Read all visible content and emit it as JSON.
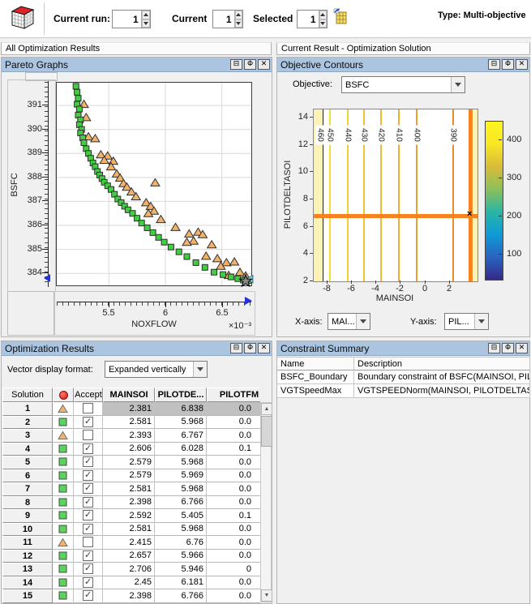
{
  "toolbar": {
    "cube_icon": "multiobjective-cube-icon",
    "current_run_label": "Current run:",
    "current_run_value": "1",
    "current_label": "Current",
    "current_value": "1",
    "selected_label": "Selected",
    "selected_value": "1",
    "select_solution_icon": "select-solution-table-icon",
    "type_text": "Type: Multi-objective"
  },
  "sections": {
    "left_header": "All Optimization Results",
    "right_header": "Current Result - Optimization Solution"
  },
  "panel_buttons": {
    "split": "⊟",
    "dock": "Φ",
    "close": "✕"
  },
  "pareto_panel": {
    "title": "Pareto Graphs"
  },
  "contours_panel": {
    "title": "Objective Contours",
    "objective_label": "Objective:",
    "objective_value": "BSFC",
    "xaxis_label": "X-axis:",
    "xaxis_value": "MAI...",
    "yaxis_label": "Y-axis:",
    "yaxis_value": "PIL..."
  },
  "results_panel": {
    "title": "Optimization Results",
    "vector_format_label": "Vector display format:",
    "vector_format_value": "Expanded vertically",
    "columns": {
      "solution": "Solution",
      "accept": "Accept",
      "mainsoi": "MAINSOI",
      "pilotde": "PILOTDE...",
      "pilotfm": "PILOTFM"
    },
    "rows": [
      {
        "solution": "1",
        "marker": "triangle",
        "accept": false,
        "selected": true,
        "mainsoi": "2.381",
        "pilotde": "6.838",
        "pilotfm": "0.0"
      },
      {
        "solution": "2",
        "marker": "square",
        "accept": true,
        "selected": false,
        "mainsoi": "2.581",
        "pilotde": "5.968",
        "pilotfm": "0.0"
      },
      {
        "solution": "3",
        "marker": "triangle",
        "accept": false,
        "selected": false,
        "mainsoi": "2.393",
        "pilotde": "6.767",
        "pilotfm": "0.0"
      },
      {
        "solution": "4",
        "marker": "square",
        "accept": true,
        "selected": false,
        "mainsoi": "2.606",
        "pilotde": "6.028",
        "pilotfm": "0.1"
      },
      {
        "solution": "5",
        "marker": "square",
        "accept": true,
        "selected": false,
        "mainsoi": "2.579",
        "pilotde": "5.968",
        "pilotfm": "0.0"
      },
      {
        "solution": "6",
        "marker": "square",
        "accept": true,
        "selected": false,
        "mainsoi": "2.579",
        "pilotde": "5.969",
        "pilotfm": "0.0"
      },
      {
        "solution": "7",
        "marker": "square",
        "accept": true,
        "selected": false,
        "mainsoi": "2.581",
        "pilotde": "5.968",
        "pilotfm": "0.0"
      },
      {
        "solution": "8",
        "marker": "square",
        "accept": true,
        "selected": false,
        "mainsoi": "2.398",
        "pilotde": "6.766",
        "pilotfm": "0.0"
      },
      {
        "solution": "9",
        "marker": "square",
        "accept": true,
        "selected": false,
        "mainsoi": "2.592",
        "pilotde": "5.405",
        "pilotfm": "0.1"
      },
      {
        "solution": "10",
        "marker": "square",
        "accept": true,
        "selected": false,
        "mainsoi": "2.581",
        "pilotde": "5.968",
        "pilotfm": "0.0"
      },
      {
        "solution": "11",
        "marker": "triangle",
        "accept": false,
        "selected": false,
        "mainsoi": "2.415",
        "pilotde": "6.76",
        "pilotfm": "0.0"
      },
      {
        "solution": "12",
        "marker": "square",
        "accept": true,
        "selected": false,
        "mainsoi": "2.657",
        "pilotde": "5.966",
        "pilotfm": "0.0"
      },
      {
        "solution": "13",
        "marker": "square",
        "accept": true,
        "selected": false,
        "mainsoi": "2.706",
        "pilotde": "5.946",
        "pilotfm": "0"
      },
      {
        "solution": "14",
        "marker": "square",
        "accept": true,
        "selected": false,
        "mainsoi": "2.45",
        "pilotde": "6.181",
        "pilotfm": "0.0"
      },
      {
        "solution": "15",
        "marker": "square",
        "accept": true,
        "selected": false,
        "mainsoi": "2.398",
        "pilotde": "6.766",
        "pilotfm": "0.0"
      }
    ]
  },
  "constraints_panel": {
    "title": "Constraint Summary",
    "columns": {
      "name": "Name",
      "description": "Description"
    },
    "rows": [
      {
        "name": "BSFC_Boundary",
        "description": "Boundary constraint of BSFC(MAINSOI, PILOT"
      },
      {
        "name": "VGTSpeedMax",
        "description": "VGTSPEEDNorm(MAINSOI, PILOTDELTASOI, P"
      }
    ]
  },
  "chart_data": [
    {
      "type": "scatter",
      "title": "Pareto Graphs",
      "xlabel": "NOXFLOW",
      "x_scale_note": "×10⁻³",
      "ylabel": "BSFC",
      "x_unit": "1e-3",
      "xlim": [
        5.04,
        6.76
      ],
      "ylim": [
        383.5,
        391.95
      ],
      "xticks": [
        5.5,
        6,
        6.5
      ],
      "yticks": [
        384,
        385,
        386,
        387,
        388,
        389,
        390,
        391
      ],
      "grid": true,
      "series": [
        {
          "name": "dominated-solutions",
          "marker": "triangle",
          "color": "#f3b269",
          "points": [
            [
              5.28,
              391.05
            ],
            [
              5.3,
              390.5
            ],
            [
              5.32,
              389.7
            ],
            [
              5.38,
              389.62
            ],
            [
              5.43,
              388.95
            ],
            [
              5.49,
              388.9
            ],
            [
              5.46,
              388.72
            ],
            [
              5.54,
              388.68
            ],
            [
              5.52,
              388.45
            ],
            [
              5.57,
              388.15
            ],
            [
              5.6,
              387.98
            ],
            [
              5.63,
              387.75
            ],
            [
              5.66,
              387.6
            ],
            [
              5.91,
              387.78
            ],
            [
              5.7,
              387.4
            ],
            [
              5.74,
              387.2
            ],
            [
              5.83,
              386.95
            ],
            [
              5.87,
              386.8
            ],
            [
              5.9,
              386.6
            ],
            [
              5.85,
              386.5
            ],
            [
              5.96,
              386.25
            ],
            [
              6.09,
              385.92
            ],
            [
              6.21,
              385.65
            ],
            [
              6.29,
              385.72
            ],
            [
              6.33,
              385.62
            ],
            [
              6.25,
              385.35
            ],
            [
              6.19,
              385.3
            ],
            [
              6.41,
              385.2
            ],
            [
              6.36,
              384.72
            ],
            [
              6.46,
              384.62
            ],
            [
              6.54,
              384.45
            ],
            [
              6.61,
              384.48
            ],
            [
              6.49,
              384.3
            ],
            [
              6.66,
              384.05
            ],
            [
              6.56,
              383.92
            ],
            [
              6.71,
              383.9
            ]
          ]
        },
        {
          "name": "pareto-front-solutions",
          "marker": "square",
          "color": "#3fcf3f",
          "points": [
            [
              5.21,
              391.8
            ],
            [
              5.22,
              391.55
            ],
            [
              5.23,
              391.3
            ],
            [
              5.22,
              391.05
            ],
            [
              5.24,
              390.85
            ],
            [
              5.23,
              390.6
            ],
            [
              5.25,
              390.4
            ],
            [
              5.24,
              390.2
            ],
            [
              5.26,
              390.0
            ],
            [
              5.25,
              389.85
            ],
            [
              5.27,
              389.65
            ],
            [
              5.28,
              389.45
            ],
            [
              5.3,
              389.2
            ],
            [
              5.32,
              389.0
            ],
            [
              5.34,
              388.8
            ],
            [
              5.36,
              388.6
            ],
            [
              5.38,
              388.45
            ],
            [
              5.4,
              388.25
            ],
            [
              5.42,
              388.1
            ],
            [
              5.44,
              387.95
            ],
            [
              5.46,
              387.8
            ],
            [
              5.49,
              387.65
            ],
            [
              5.52,
              387.5
            ],
            [
              5.55,
              387.3
            ],
            [
              5.58,
              387.1
            ],
            [
              5.61,
              386.95
            ],
            [
              5.64,
              386.8
            ],
            [
              5.67,
              386.65
            ],
            [
              5.71,
              386.5
            ],
            [
              5.75,
              386.3
            ],
            [
              5.79,
              386.1
            ],
            [
              5.84,
              385.9
            ],
            [
              5.89,
              385.7
            ],
            [
              5.94,
              385.5
            ],
            [
              5.99,
              385.3
            ],
            [
              6.05,
              385.1
            ],
            [
              6.12,
              384.9
            ],
            [
              6.19,
              384.7
            ],
            [
              6.27,
              384.45
            ],
            [
              6.35,
              384.25
            ],
            [
              6.43,
              384.05
            ],
            [
              6.51,
              383.95
            ],
            [
              6.58,
              383.85
            ],
            [
              6.64,
              383.78
            ],
            [
              6.69,
              383.72
            ],
            [
              6.73,
              383.7
            ]
          ]
        },
        {
          "name": "current-solution",
          "marker": "triangle-left",
          "color": "#8adbe8",
          "points": [
            [
              6.745,
              383.76
            ]
          ]
        },
        {
          "name": "selected-solution",
          "marker": "star",
          "color": "#888888",
          "points": [
            [
              6.71,
              383.68
            ]
          ]
        }
      ]
    },
    {
      "type": "contour",
      "objective": "BSFC",
      "xlabel": "MAINSOI",
      "ylabel": "PILOTDELTASOI",
      "xlim": [
        -9.1,
        4.25
      ],
      "ylim": [
        2,
        14.6
      ],
      "xticks": [
        -8,
        -6,
        -4,
        -2,
        0,
        2
      ],
      "yticks": [
        2,
        4,
        6,
        8,
        10,
        12,
        14
      ],
      "contour_levels": [
        {
          "value": 460,
          "x": -8.6,
          "color": "#f2e338"
        },
        {
          "value": 450,
          "x": -7.75,
          "color": "#f2dc36"
        },
        {
          "value": 440,
          "x": -6.3,
          "color": "#f1d034"
        },
        {
          "value": 430,
          "x": -5.0,
          "color": "#f0c433"
        },
        {
          "value": 420,
          "x": -3.6,
          "color": "#efb931"
        },
        {
          "value": 410,
          "x": -2.15,
          "color": "#eeac30"
        },
        {
          "value": 400,
          "x": -0.7,
          "color": "#ed9f2e"
        },
        {
          "value": 390,
          "x": 2.25,
          "color": "#ea8f28"
        }
      ],
      "boundary_band": {
        "x_from": -9.1,
        "x_to": -8.35,
        "color": "#faf3b5"
      },
      "right_band": {
        "x_from": 3.95,
        "x_to": 4.25,
        "color": "#faf3b5"
      },
      "solution_lines": {
        "x": 3.65,
        "y": 6.8,
        "color": "#f8821e"
      },
      "marker": {
        "x": 3.65,
        "y": 6.8,
        "glyph": "×"
      },
      "colorbar": {
        "ticks": [
          400,
          300,
          200,
          100
        ],
        "vmin": 35,
        "vmax": 448,
        "gradient": [
          "#fdf521",
          "#f9e625",
          "#d9bb3a",
          "#8ac05a",
          "#2ab5a5",
          "#0f9bd7",
          "#2a63c0",
          "#352a87"
        ]
      }
    }
  ]
}
